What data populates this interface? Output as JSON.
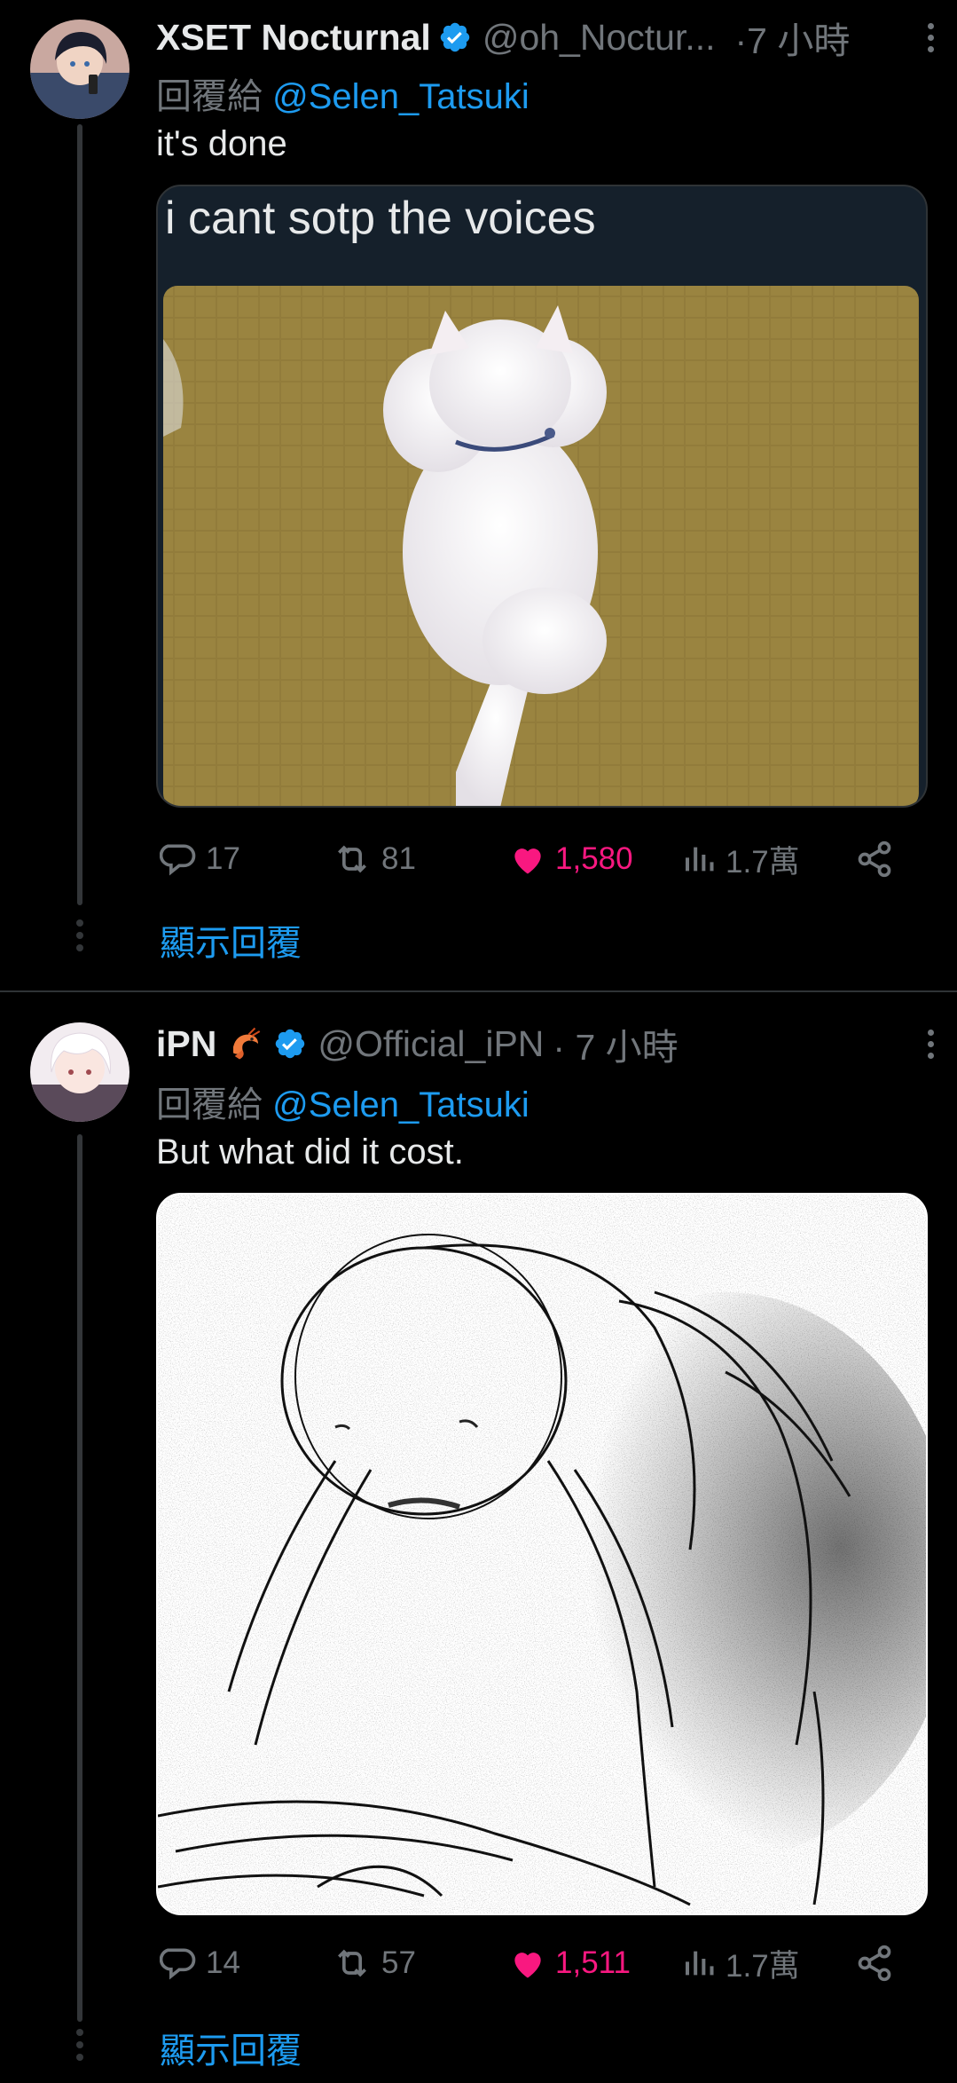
{
  "tweets": [
    {
      "display_name": "XSET Nocturnal",
      "handle": "@oh_Noctur...",
      "time": "·7 小時",
      "reply_prefix": "回覆給",
      "reply_mention": "@Selen_Tatsuki",
      "text": "it's done",
      "media_caption": "i cant sotp the voices",
      "replies": "17",
      "reposts": "81",
      "likes": "1,580",
      "views": "1.7萬",
      "show_replies": "顯示回覆"
    },
    {
      "display_name": "iPN",
      "handle": "@Official_iPN",
      "time": "· 7 小時",
      "reply_prefix": "回覆給",
      "reply_mention": "@Selen_Tatsuki",
      "text": "But what did it cost.",
      "replies": "14",
      "reposts": "57",
      "likes": "1,511",
      "views": "1.7萬",
      "show_replies": "顯示回覆"
    }
  ],
  "colors": {
    "background": "#000000",
    "text": "#e7e9ea",
    "secondary": "#71767b",
    "link": "#1d9bf0",
    "like": "#f91880",
    "verified": "#1d9bf0"
  },
  "icons": [
    "verified-badge-icon",
    "more-icon",
    "reply-icon",
    "repost-icon",
    "heart-icon",
    "views-icon",
    "share-icon",
    "shrimp-emoji-icon"
  ]
}
